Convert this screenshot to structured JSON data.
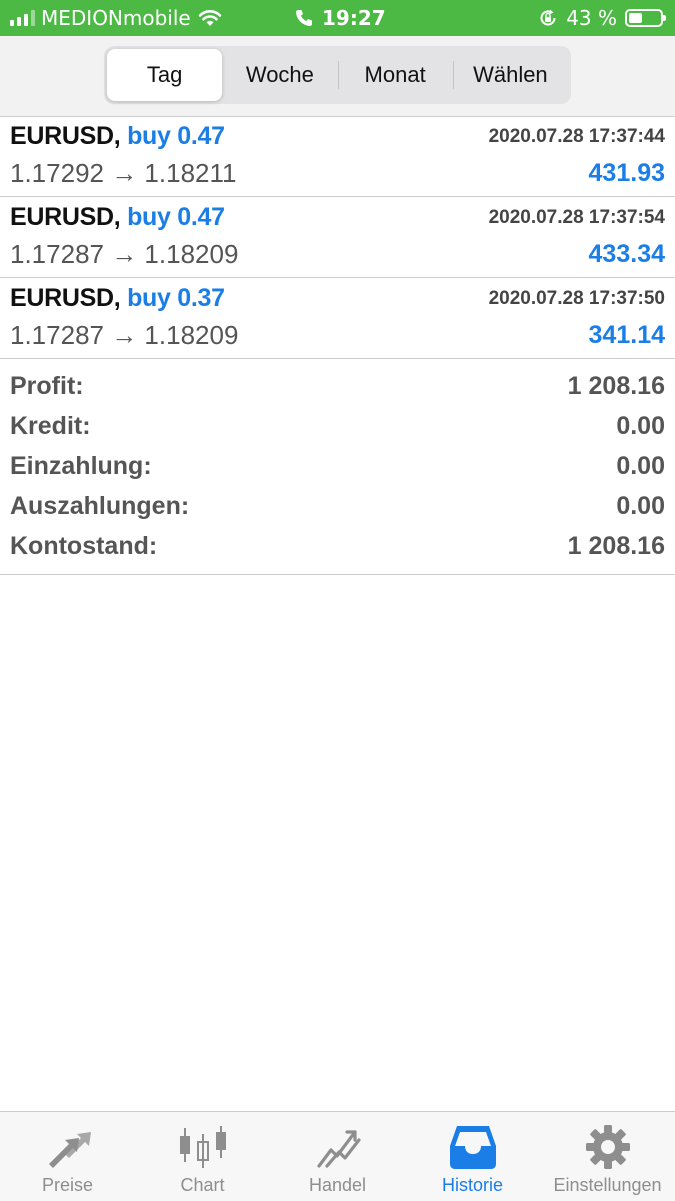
{
  "status_bar": {
    "carrier": "MEDIONmobile",
    "time": "19:27",
    "battery_percent": "43 %",
    "battery_level": 0.43,
    "background_color": "#4cb944",
    "icons": [
      "signal-bars-icon",
      "wifi-icon",
      "phone-icon",
      "orientation-lock-icon",
      "battery-icon"
    ]
  },
  "period_tabs": [
    {
      "label": "Tag",
      "selected": true
    },
    {
      "label": "Woche",
      "selected": false
    },
    {
      "label": "Monat",
      "selected": false
    },
    {
      "label": "Wählen",
      "selected": false
    }
  ],
  "deals": [
    {
      "symbol": "EURUSD,",
      "type": "buy 0.47",
      "time": "2020.07.28 17:37:44",
      "prices": "1.17292 → 1.18211",
      "profit": "431.93"
    },
    {
      "symbol": "EURUSD,",
      "type": "buy 0.47",
      "time": "2020.07.28 17:37:54",
      "prices": "1.17287 → 1.18209",
      "profit": "433.34"
    },
    {
      "symbol": "EURUSD,",
      "type": "buy 0.37",
      "time": "2020.07.28 17:37:50",
      "prices": "1.17287 → 1.18209",
      "profit": "341.14"
    }
  ],
  "summary": [
    {
      "label": "Profit:",
      "value": "1 208.16"
    },
    {
      "label": "Kredit:",
      "value": "0.00"
    },
    {
      "label": "Einzahlung:",
      "value": "0.00"
    },
    {
      "label": "Auszahlungen:",
      "value": "0.00"
    },
    {
      "label": "Kontostand:",
      "value": "1 208.16"
    }
  ],
  "tab_bar": [
    {
      "label": "Preise",
      "icon": "quotes-arrows-icon",
      "active": false
    },
    {
      "label": "Chart",
      "icon": "candlestick-icon",
      "active": false
    },
    {
      "label": "Handel",
      "icon": "trade-chart-icon",
      "active": false
    },
    {
      "label": "Historie",
      "icon": "inbox-tray-icon",
      "active": true
    },
    {
      "label": "Einstellungen",
      "icon": "gear-icon",
      "active": false
    }
  ],
  "colors": {
    "accent": "#1a7ee6",
    "text_gray": "#555555",
    "tab_inactive": "#8e8e8e"
  }
}
